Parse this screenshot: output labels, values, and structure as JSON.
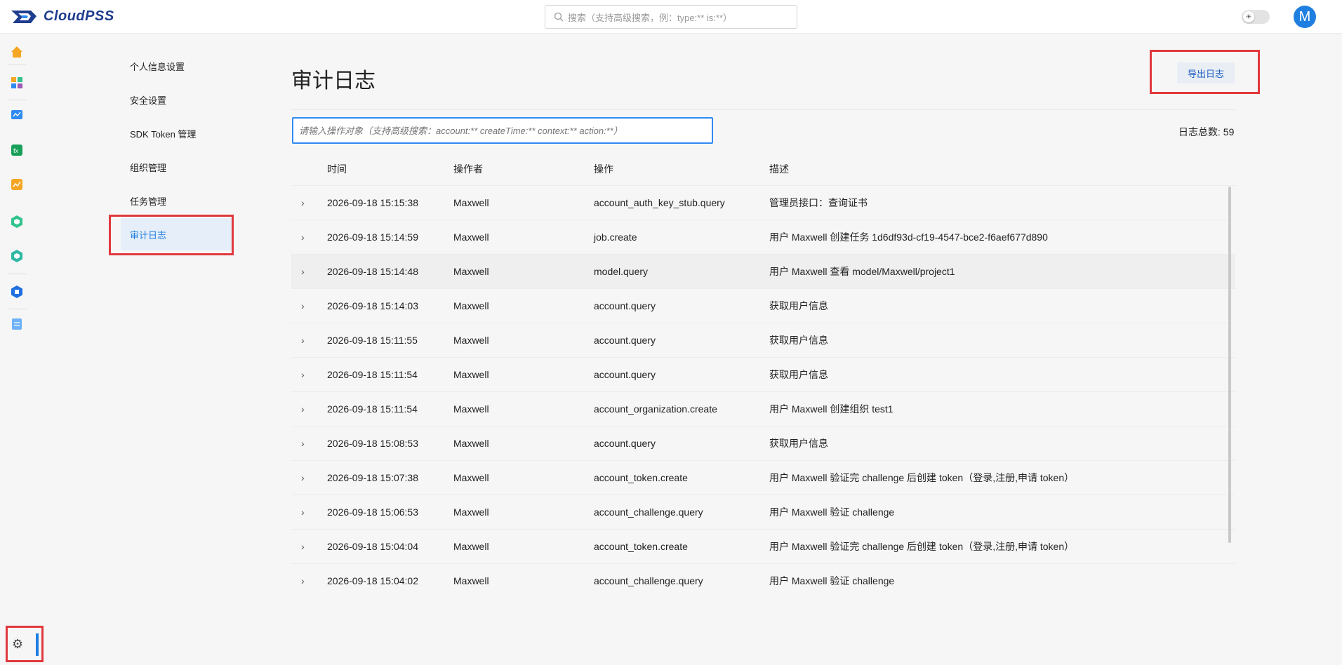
{
  "header": {
    "logo_text": "CloudPSS",
    "search_placeholder": "搜索（支持高级搜索，例：type:** is:**）",
    "theme_toggle_icon": "sun-icon",
    "avatar_initial": "M",
    "colors": {
      "brand": "#1f3d8f",
      "accent": "#1f7fe0",
      "highlight_border": "#e0393e"
    }
  },
  "rail": {
    "icons": [
      "home-icon",
      "apps-icon",
      "monitor-icon",
      "simulation-icon",
      "chart-icon",
      "hexagon-app-icon",
      "hexagon-app-2-icon",
      "database-icon",
      "document-icon"
    ],
    "settings_icon": "gear-icon"
  },
  "menu": {
    "items": [
      {
        "label": "个人信息设置",
        "active": false
      },
      {
        "label": "安全设置",
        "active": false
      },
      {
        "label": "SDK Token 管理",
        "active": false
      },
      {
        "label": "组织管理",
        "active": false
      },
      {
        "label": "任务管理",
        "active": false
      },
      {
        "label": "审计日志",
        "active": true
      }
    ]
  },
  "main": {
    "title": "审计日志",
    "export_label": "导出日志",
    "filter_placeholder": "请输入操作对象（支持高级搜索：account:** createTime:** context:** action:**）",
    "count_label": "日志总数: 59"
  },
  "table": {
    "columns": [
      "时间",
      "操作者",
      "操作",
      "描述"
    ],
    "rows": [
      {
        "time": "2026-09-18 15:15:38",
        "user": "Maxwell",
        "action": "account_auth_key_stub.query",
        "desc": "管理员接口：查询证书"
      },
      {
        "time": "2026-09-18 15:14:59",
        "user": "Maxwell",
        "action": "job.create",
        "desc": "用户 Maxwell 创建任务 1d6df93d-cf19-4547-bce2-f6aef677d890"
      },
      {
        "time": "2026-09-18 15:14:48",
        "user": "Maxwell",
        "action": "model.query",
        "desc": "用户 Maxwell 查看 model/Maxwell/project1"
      },
      {
        "time": "2026-09-18 15:14:03",
        "user": "Maxwell",
        "action": "account.query",
        "desc": "获取用户信息"
      },
      {
        "time": "2026-09-18 15:11:55",
        "user": "Maxwell",
        "action": "account.query",
        "desc": "获取用户信息"
      },
      {
        "time": "2026-09-18 15:11:54",
        "user": "Maxwell",
        "action": "account.query",
        "desc": "获取用户信息"
      },
      {
        "time": "2026-09-18 15:11:54",
        "user": "Maxwell",
        "action": "account_organization.create",
        "desc": "用户 Maxwell 创建组织 test1"
      },
      {
        "time": "2026-09-18 15:08:53",
        "user": "Maxwell",
        "action": "account.query",
        "desc": "获取用户信息"
      },
      {
        "time": "2026-09-18 15:07:38",
        "user": "Maxwell",
        "action": "account_token.create",
        "desc": "用户 Maxwell 验证完 challenge 后创建 token（登录,注册,申请 token）"
      },
      {
        "time": "2026-09-18 15:06:53",
        "user": "Maxwell",
        "action": "account_challenge.query",
        "desc": "用户 Maxwell 验证 challenge"
      },
      {
        "time": "2026-09-18 15:04:04",
        "user": "Maxwell",
        "action": "account_token.create",
        "desc": "用户 Maxwell 验证完 challenge 后创建 token（登录,注册,申请 token）"
      },
      {
        "time": "2026-09-18 15:04:02",
        "user": "Maxwell",
        "action": "account_challenge.query",
        "desc": "用户 Maxwell 验证 challenge"
      }
    ]
  }
}
